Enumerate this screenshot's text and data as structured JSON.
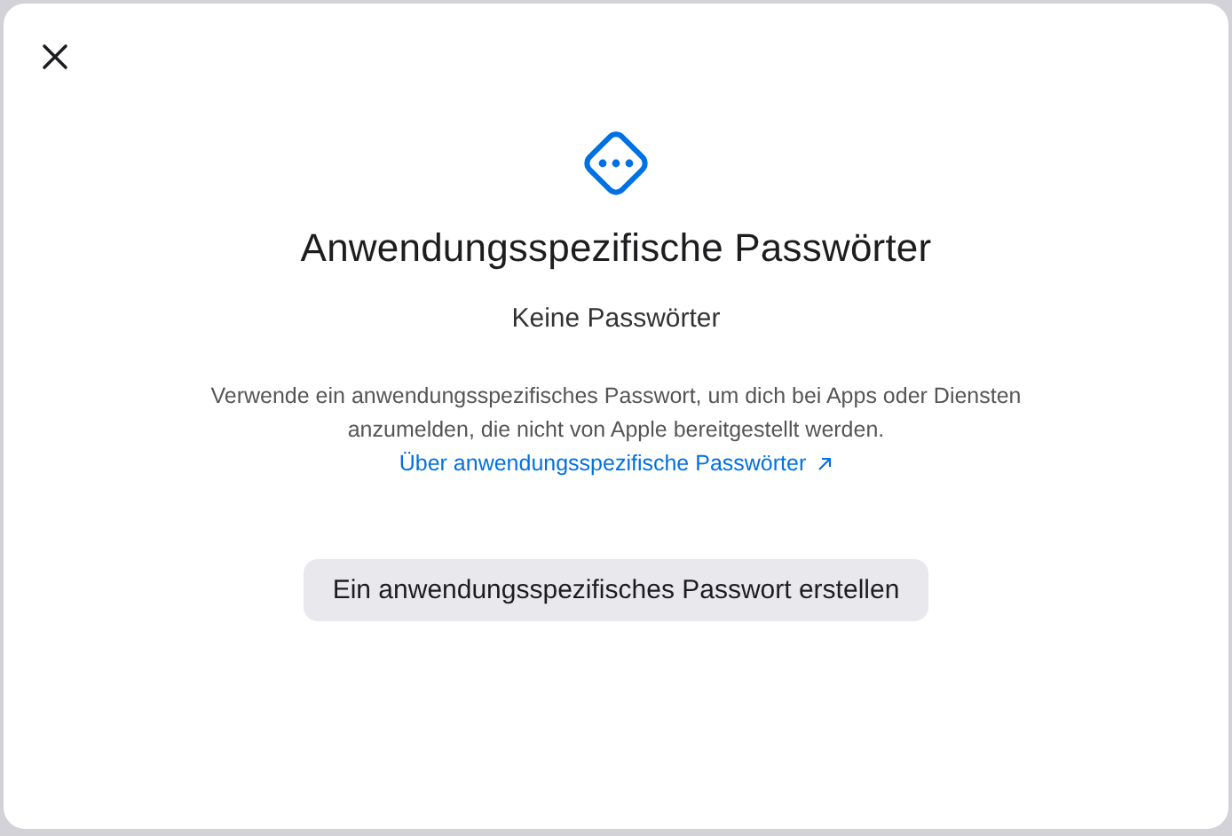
{
  "dialog": {
    "title": "Anwendungsspezifische Passwörter",
    "subtitle": "Keine Passwörter",
    "description": "Verwende ein anwendungsspezifisches Passwort, um dich bei Apps oder Diensten anzumelden, die nicht von Apple bereitgestellt werden.",
    "link": "Über anwendungsspezifische Passwörter",
    "button": "Ein anwendungsspezifisches Passwort erstellen"
  }
}
